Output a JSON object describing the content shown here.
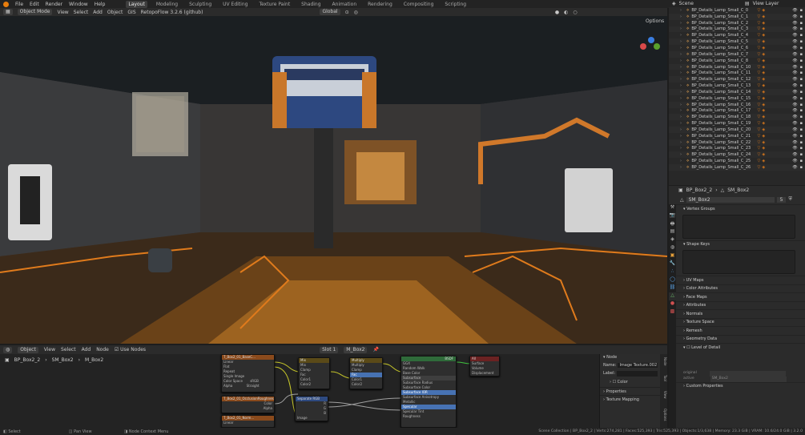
{
  "top_menu": {
    "items": [
      "File",
      "Edit",
      "Render",
      "Window",
      "Help"
    ],
    "workspaces": [
      "Layout",
      "Modeling",
      "Sculpting",
      "UV Editing",
      "Texture Paint",
      "Shading",
      "Animation",
      "Rendering",
      "Compositing",
      "Scripting"
    ],
    "active_workspace": "Layout",
    "scene_label": "Scene",
    "view_layer_label": "View Layer"
  },
  "viewport_header": {
    "mode": "Object Mode",
    "menus": [
      "View",
      "Select",
      "Add",
      "Object",
      "GIS"
    ],
    "addon": "RetopoFlow 3.2.6 (github)",
    "transform": "Global",
    "options": "Options"
  },
  "node_editor": {
    "header_mode": "Object",
    "menus": [
      "View",
      "Select",
      "Add",
      "Node"
    ],
    "use_nodes_label": "Use Nodes",
    "slot": "Slot 1",
    "material": "M_Box2",
    "breadcrumb": [
      "BP_Box2_2",
      "SM_Box2",
      "M_Box2"
    ],
    "nodes": {
      "tex1": {
        "title": "T_Box2_01_BaseC...",
        "rows": [
          "Linear",
          "Flat",
          "Repeat",
          "Single Image",
          "Color Space",
          "sRGB",
          "Alpha",
          "Straight"
        ]
      },
      "tex2": {
        "title": "T_Box2_01_OcclusionRoughnessMetallic",
        "rows": [
          "Color",
          "Alpha"
        ]
      },
      "tex3": {
        "title": "T_Box2_01_Norm...",
        "rows": [
          "Linear"
        ]
      },
      "mix1": {
        "title": "Mix",
        "rows": [
          "Mix",
          "Clamp",
          "Fac",
          "Color1",
          "Color2"
        ]
      },
      "mix2": {
        "title": "Multiply",
        "rows": [
          "Multiply",
          "Clamp",
          "Fac",
          "Color1",
          "Color2"
        ]
      },
      "sep": {
        "title": "Separate RGB",
        "rows": [
          "R",
          "G",
          "B",
          "Image"
        ]
      },
      "bsdf": {
        "title": "BSDF",
        "rows": [
          "GGX",
          "Random Walk",
          "Base Color",
          "Subsurface",
          "Subsurface Radius",
          "Subsurface Color",
          "Subsurface IOR",
          "Subsurface Anisotropy",
          "Metallic",
          "Specular",
          "Specular Tint",
          "Roughness"
        ]
      },
      "out": {
        "title": "All",
        "rows": [
          "Surface",
          "Volume",
          "Displacement"
        ]
      }
    }
  },
  "node_panel": {
    "title": "Node",
    "name_label": "Name:",
    "name_value": "Image Texture.002",
    "label_label": "Label:",
    "color": "Color",
    "properties": "Properties",
    "texture_mapping": "Texture Mapping",
    "tabs": [
      "Node",
      "Tool",
      "View",
      "Options"
    ]
  },
  "status_bar": {
    "select": "Select",
    "pan": "Pan View",
    "context": "Node Context Menu",
    "stats": "Scene Collection | BP_Box2_2 | Verts:274,281 | Faces:525,393 | Tris:525,393 | Objects:1/3,638 | Memory: 23.3 GiB | VRAM: 10.6/24.0 GiB | 3.2.0"
  },
  "outliner": {
    "items": [
      "BP_Details_Lamp_Small_C_0",
      "BP_Details_Lamp_Small_C_1",
      "BP_Details_Lamp_Small_C_2",
      "BP_Details_Lamp_Small_C_3",
      "BP_Details_Lamp_Small_C_4",
      "BP_Details_Lamp_Small_C_5",
      "BP_Details_Lamp_Small_C_6",
      "BP_Details_Lamp_Small_C_7",
      "BP_Details_Lamp_Small_C_8",
      "BP_Details_Lamp_Small_C_10",
      "BP_Details_Lamp_Small_C_11",
      "BP_Details_Lamp_Small_C_12",
      "BP_Details_Lamp_Small_C_13",
      "BP_Details_Lamp_Small_C_14",
      "BP_Details_Lamp_Small_C_15",
      "BP_Details_Lamp_Small_C_16",
      "BP_Details_Lamp_Small_C_17",
      "BP_Details_Lamp_Small_C_18",
      "BP_Details_Lamp_Small_C_19",
      "BP_Details_Lamp_Small_C_20",
      "BP_Details_Lamp_Small_C_21",
      "BP_Details_Lamp_Small_C_22",
      "BP_Details_Lamp_Small_C_23",
      "BP_Details_Lamp_Small_C_24",
      "BP_Details_Lamp_Small_C_25",
      "BP_Details_Lamp_Small_C_26"
    ]
  },
  "properties": {
    "breadcrumb": [
      "BP_Box2_2",
      "SM_Box2"
    ],
    "mesh_name": "SM_Box2",
    "users": "5",
    "sections": {
      "vertex_groups": "Vertex Groups",
      "shape_keys": "Shape Keys",
      "uv_maps": "UV Maps",
      "color_attributes": "Color Attributes",
      "face_maps": "Face Maps",
      "attributes": "Attributes",
      "normals": "Normals",
      "texture_space": "Texture Space",
      "remesh": "Remesh",
      "geometry_data": "Geometry Data",
      "level_of_detail": "Level of Detail",
      "custom_properties": "Custom Properties"
    },
    "lod_original_label": "original",
    "lod_active_label": "active",
    "lod_active_value": "SM_Box2"
  },
  "colors": {
    "accent": "#e87d0d",
    "node_texture": "#8a4a1c",
    "node_color": "#5a4a18",
    "node_shader": "#2f6b3a",
    "node_output": "#6b2222"
  }
}
